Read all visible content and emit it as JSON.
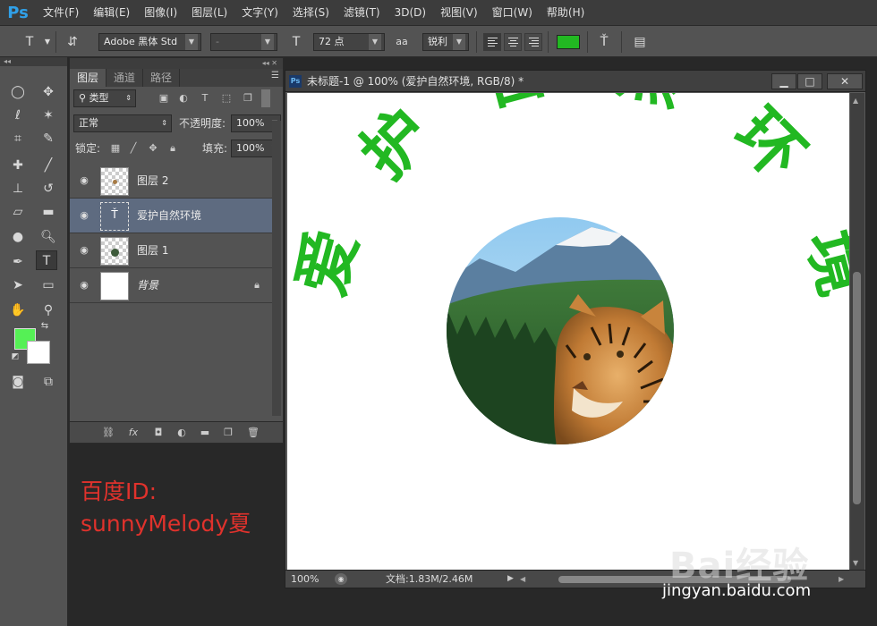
{
  "app": {
    "logo": "Ps"
  },
  "menu": [
    "文件(F)",
    "编辑(E)",
    "图像(I)",
    "图层(L)",
    "文字(Y)",
    "选择(S)",
    "滤镜(T)",
    "3D(D)",
    "视图(V)",
    "窗口(W)",
    "帮助(H)"
  ],
  "options": {
    "tool_icon": "T",
    "font_family": "Adobe 黑体 Std",
    "font_style": "-",
    "font_size": "72 点",
    "aa_icon": "aa",
    "antialias": "锐利",
    "text_color": "#22b822"
  },
  "layers_panel": {
    "tabs": [
      "图层",
      "通道",
      "路径"
    ],
    "filter_kind": "类型",
    "blend_mode": "正常",
    "opacity_label": "不透明度:",
    "opacity_value": "100%",
    "lock_label": "锁定:",
    "fill_label": "填充:",
    "fill_value": "100%",
    "layers": [
      {
        "name": "图层 2",
        "thumb": "checker",
        "selected": false
      },
      {
        "name": "爱护自然环境",
        "thumb": "text",
        "selected": true
      },
      {
        "name": "图层 1",
        "thumb": "checker",
        "selected": false
      },
      {
        "name": "背景",
        "thumb": "white",
        "selected": false,
        "locked": true
      }
    ]
  },
  "watermark_left": {
    "line1": "百度ID:",
    "line2": "sunnyMelody夏"
  },
  "document": {
    "title": "未标题-1 @ 100% (爱护自然环境, RGB/8) *",
    "arc_text": "爱护自然环境",
    "arc_color": "#22b822",
    "zoom": "100%",
    "doc_size": "文档:1.83M/2.46M"
  },
  "site_watermark": {
    "logo": "Bai经验",
    "url": "jingyan.baidu.com"
  },
  "colors": {
    "foreground": "#55f055",
    "background": "#ffffff"
  }
}
